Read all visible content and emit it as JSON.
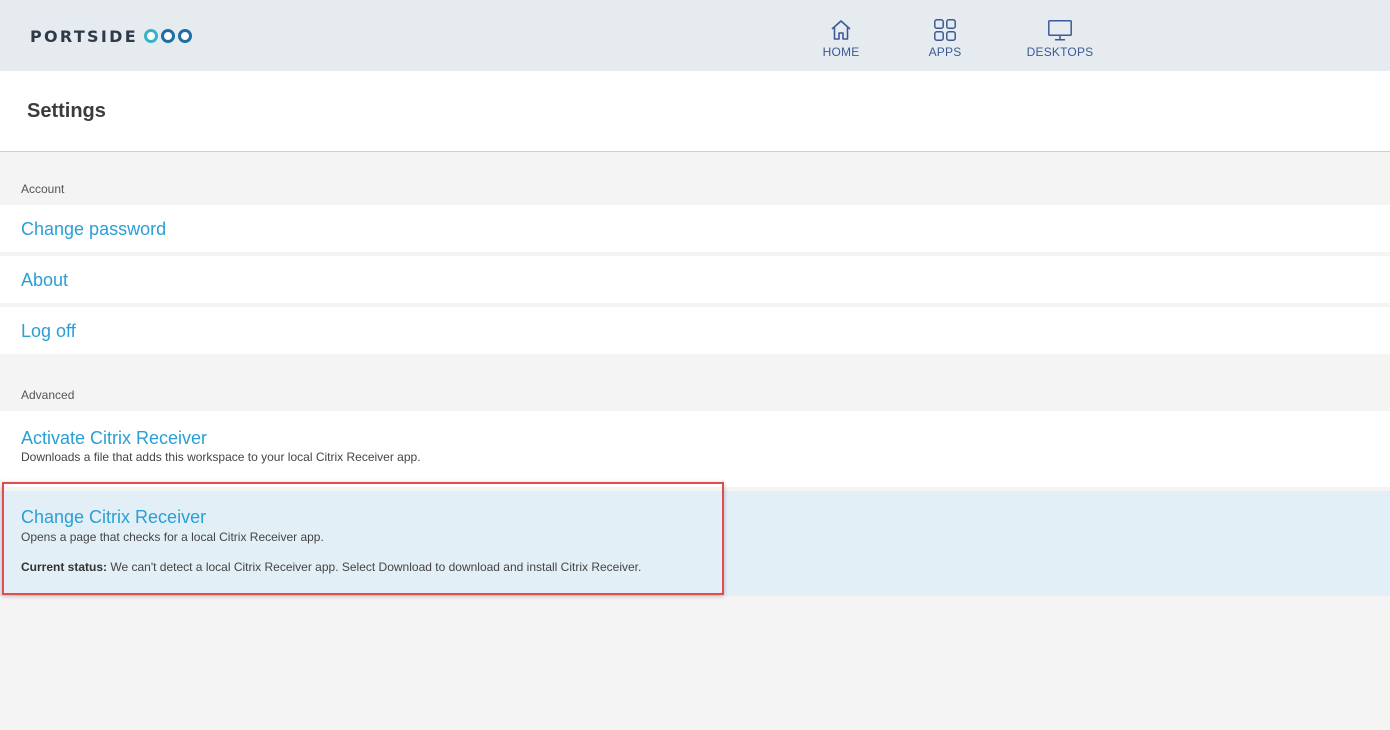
{
  "header": {
    "logo_text": "PORTSIDE",
    "nav": [
      {
        "label": "HOME",
        "icon": "home-icon"
      },
      {
        "label": "APPS",
        "icon": "apps-grid-icon"
      },
      {
        "label": "DESKTOPS",
        "icon": "monitor-icon"
      }
    ]
  },
  "page": {
    "title": "Settings"
  },
  "account": {
    "section_label": "Account",
    "items": [
      {
        "label": "Change password"
      },
      {
        "label": "About"
      },
      {
        "label": "Log off"
      }
    ]
  },
  "advanced": {
    "section_label": "Advanced",
    "items": [
      {
        "label": "Activate Citrix Receiver",
        "description": "Downloads a file that adds this workspace to your local Citrix Receiver app."
      },
      {
        "label": "Change Citrix Receiver",
        "description": "Opens a page that checks for a local Citrix Receiver app.",
        "status_label": "Current status:",
        "status_text": "We can't detect a local Citrix Receiver app. Select Download to download and install Citrix Receiver."
      }
    ]
  },
  "colors": {
    "link": "#2a9fd6",
    "nav": "#3c5a96",
    "header_bg": "#e6ebf0",
    "selected_bg": "#e3eff6",
    "highlight": "#e14c4c"
  }
}
